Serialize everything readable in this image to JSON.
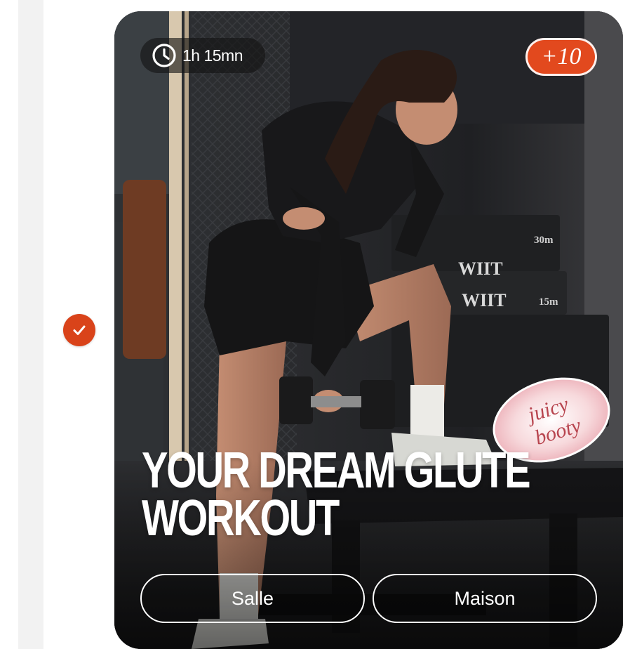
{
  "workout": {
    "duration": "1h 15mn",
    "points": "+10",
    "title_line1": "YOUR DREAM GLUTE",
    "title_line2": "WORKOUT",
    "sticker_text_1": "juicy",
    "sticker_text_2": "booty",
    "equipment_text_1": "WIIT",
    "equipment_text_2": "WIIT",
    "equipment_weight_1": "30m",
    "equipment_weight_2": "15m",
    "completed": true,
    "locations": [
      "Salle",
      "Maison"
    ]
  },
  "icons": {
    "completed": "check-icon",
    "duration": "clock-icon"
  },
  "colors": {
    "accent": "#d9431a",
    "points_badge": "#e2491e",
    "card_text": "#ffffff",
    "gutter": "#f2f2f2"
  }
}
